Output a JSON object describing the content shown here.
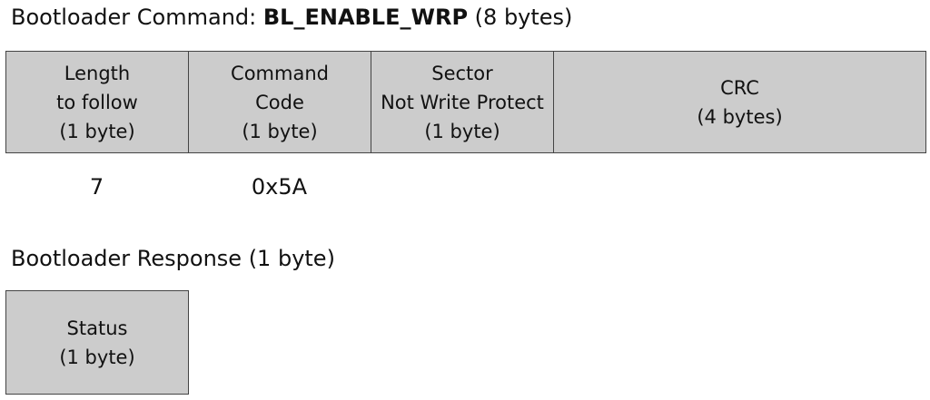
{
  "command": {
    "title_prefix": "Bootloader Command: ",
    "title_name": "BL_ENABLE_WRP",
    "title_suffix": " (8 bytes)",
    "fields": [
      {
        "line1": "Length",
        "line2": "to follow",
        "line3": "(1 byte)",
        "value": "7"
      },
      {
        "line1": "Command",
        "line2": "Code",
        "line3": "(1 byte)",
        "value": "0x5A"
      },
      {
        "line1": "Sector",
        "line2": "Not Write Protect",
        "line3": "(1 byte)",
        "value": ""
      },
      {
        "line1": "CRC",
        "line2": "(4 bytes)",
        "value": ""
      }
    ],
    "field_color": "#cccccc",
    "border_color": "#444444"
  },
  "response": {
    "title": "Bootloader Response (1 byte)",
    "fields": [
      {
        "line1": "Status",
        "line2": "(1 byte)"
      }
    ]
  }
}
